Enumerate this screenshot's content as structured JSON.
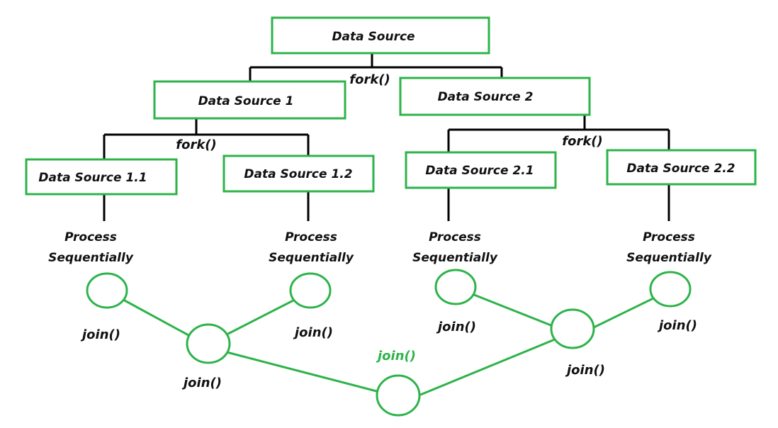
{
  "nodes": {
    "root": "Data Source",
    "ds1": "Data Source 1",
    "ds2": "Data Source 2",
    "ds11": "Data Source 1.1",
    "ds12": "Data Source 1.2",
    "ds21": "Data Source 2.1",
    "ds22": "Data Source 2.2"
  },
  "fork_label": "fork()",
  "process_line1": "Process",
  "process_line2": "Sequentially",
  "join_label": "join()",
  "colors": {
    "box_border": "#2db34a",
    "connector": "#000000",
    "join_line": "#2db34a",
    "final_join_text": "#2db34a"
  }
}
